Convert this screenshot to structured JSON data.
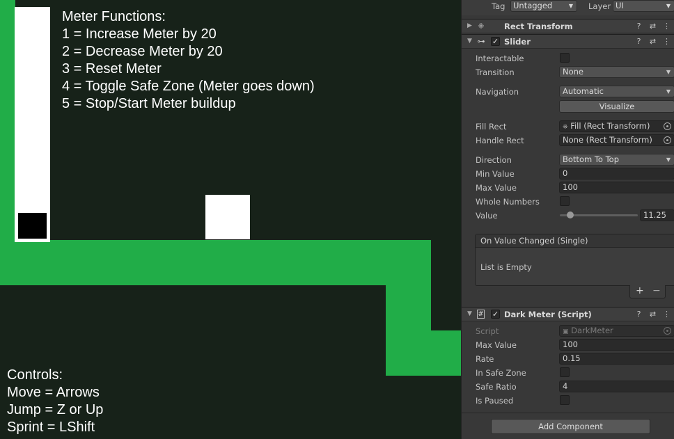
{
  "game": {
    "meter_functions": [
      "Meter Functions:",
      "1 = Increase Meter by 20",
      "2 = Decrease Meter by 20",
      "3 = Reset Meter",
      "4 = Toggle Safe Zone (Meter goes down)",
      "5 = Stop/Start Meter buildup"
    ],
    "controls": [
      "Controls:",
      "Move = Arrows",
      "Jump = Z or Up",
      "Sprint = LShift"
    ],
    "meter_value": 0.1125,
    "colors": {
      "background": "#172219",
      "ground": "#21ad48",
      "meter_bg": "#ffffff",
      "meter_fill": "#000000",
      "player": "#ffffff"
    }
  },
  "inspector": {
    "tag_label": "Tag",
    "tag_value": "Untagged",
    "layer_label": "Layer",
    "layer_value": "UI",
    "rect_transform": {
      "title": "Rect Transform"
    },
    "slider": {
      "title": "Slider",
      "interactable_label": "Interactable",
      "transition_label": "Transition",
      "transition_value": "None",
      "navigation_label": "Navigation",
      "navigation_value": "Automatic",
      "visualize_label": "Visualize",
      "fill_rect_label": "Fill Rect",
      "fill_rect_value": "Fill (Rect Transform)",
      "handle_rect_label": "Handle Rect",
      "handle_rect_value": "None (Rect Transform)",
      "direction_label": "Direction",
      "direction_value": "Bottom To Top",
      "min_value_label": "Min Value",
      "min_value": "0",
      "max_value_label": "Max Value",
      "max_value": "100",
      "whole_numbers_label": "Whole Numbers",
      "value_label": "Value",
      "value": "11.25",
      "on_value_changed_label": "On Value Changed (Single)",
      "list_empty_label": "List is Empty",
      "add_symbol": "+",
      "remove_symbol": "−"
    },
    "dark_meter": {
      "title": "Dark Meter (Script)",
      "script_label": "Script",
      "script_value": "DarkMeter",
      "max_value_label": "Max Value",
      "max_value": "100",
      "rate_label": "Rate",
      "rate": "0.15",
      "in_safe_zone_label": "In Safe Zone",
      "safe_ratio_label": "Safe Ratio",
      "safe_ratio": "4",
      "is_paused_label": "Is Paused"
    },
    "add_component_label": "Add Component"
  }
}
